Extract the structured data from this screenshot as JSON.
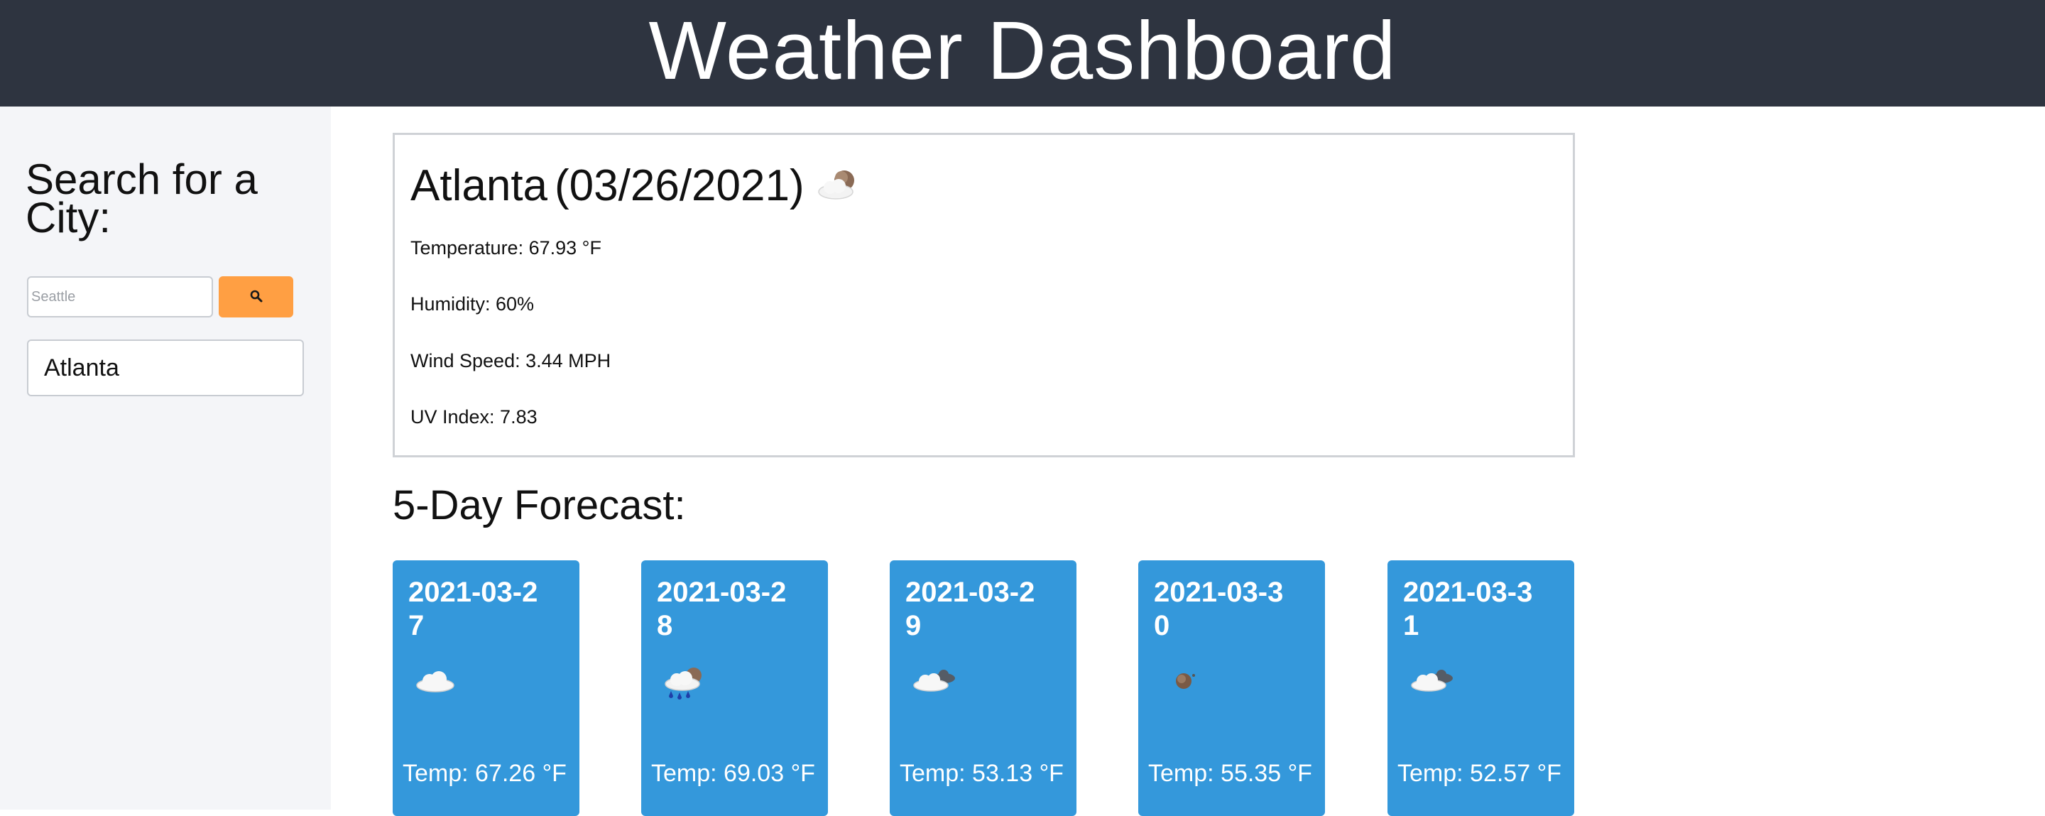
{
  "header": {
    "title": "Weather Dashboard"
  },
  "sidebar": {
    "heading": "Search for a City:",
    "search": {
      "placeholder": "Seattle",
      "value": ""
    },
    "search_button_icon": "search-icon",
    "history": [
      "Atlanta"
    ]
  },
  "current": {
    "city": "Atlanta",
    "date": "(03/26/2021)",
    "icon": "partly-cloudy-night-icon",
    "temperature": "Temperature: 67.93 °F",
    "humidity": "Humidity: 60%",
    "wind": "Wind Speed: 3.44 MPH",
    "uv": "UV Index: 7.83"
  },
  "forecast": {
    "title": "5-Day Forecast:",
    "days": [
      {
        "date": "2021-03-27",
        "icon": "cloud-icon",
        "temp": "Temp: 67.26 °F"
      },
      {
        "date": "2021-03-28",
        "icon": "rain-night-icon",
        "temp": "Temp: 69.03 °F"
      },
      {
        "date": "2021-03-29",
        "icon": "broken-clouds-icon",
        "temp": "Temp: 53.13 °F"
      },
      {
        "date": "2021-03-30",
        "icon": "clear-night-icon",
        "temp": "Temp: 55.35 °F"
      },
      {
        "date": "2021-03-31",
        "icon": "broken-clouds-icon",
        "temp": "Temp: 52.57 °F"
      }
    ]
  },
  "colors": {
    "header_bg": "#2e3440",
    "sidebar_bg": "#f4f5f8",
    "search_button": "#ff9f43",
    "card_bg": "#3498db"
  }
}
